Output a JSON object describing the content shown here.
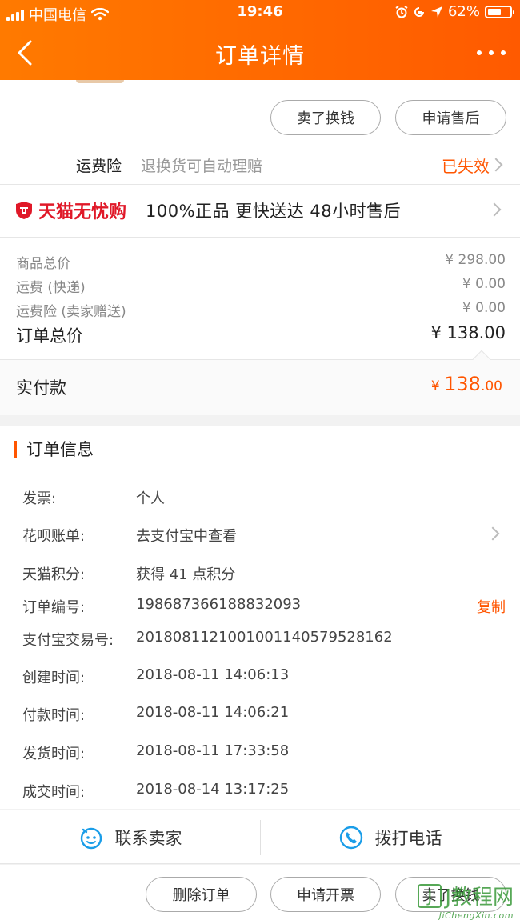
{
  "status_bar": {
    "carrier": "中国电信",
    "time": "19:46",
    "battery": "62%"
  },
  "nav": {
    "title": "订单详情"
  },
  "actions_top": {
    "sell_label": "卖了换钱",
    "aftersale_label": "申请售后"
  },
  "insurance": {
    "label": "运费险",
    "desc": "退换货可自动理赔",
    "status": "已失效"
  },
  "tmall": {
    "logo_text": "天猫无忧购",
    "promise": "100%正品  更快送达  48小时售后"
  },
  "prices": {
    "goods_label": "商品总价",
    "goods_value": "¥ 298.00",
    "shipping_label": "运费 (快递)",
    "shipping_value": "¥ 0.00",
    "ins_label": "运费险 (卖家赠送)",
    "ins_value": "¥ 0.00",
    "total_label": "订单总价",
    "total_value": "¥ 138.00",
    "paid_label": "实付款",
    "paid_currency": "¥ ",
    "paid_int": "138",
    "paid_dec": ".00"
  },
  "order_info": {
    "title": "订单信息",
    "rows": [
      {
        "k": "发票:",
        "v": "个人"
      },
      {
        "k": "花呗账单:",
        "v": "去支付宝中查看"
      },
      {
        "k": "天猫积分:",
        "v": "获得 41 点积分"
      },
      {
        "k": "订单编号:",
        "v": "198687366188832093"
      },
      {
        "k": "支付宝交易号:",
        "v": "2018081121001001140579528162"
      },
      {
        "k": "创建时间:",
        "v": "2018-08-11 14:06:13"
      },
      {
        "k": "付款时间:",
        "v": "2018-08-11 14:06:21"
      },
      {
        "k": "发货时间:",
        "v": "2018-08-11 17:33:58"
      },
      {
        "k": "成交时间:",
        "v": "2018-08-14 13:17:25"
      }
    ],
    "copy_label": "复制"
  },
  "contact": {
    "seller_label": "联系卖家",
    "phone_label": "拨打电话"
  },
  "bottom": {
    "delete_label": "删除订单",
    "invoice_label": "申请开票",
    "sell_label": "卖了换钱"
  },
  "watermark": {
    "mark": "J",
    "text": "J教程网",
    "url": "JiChengXin.com"
  },
  "colors": {
    "header": "#ff6a00",
    "accent": "#ff5500",
    "tmall_red": "#e01828"
  }
}
